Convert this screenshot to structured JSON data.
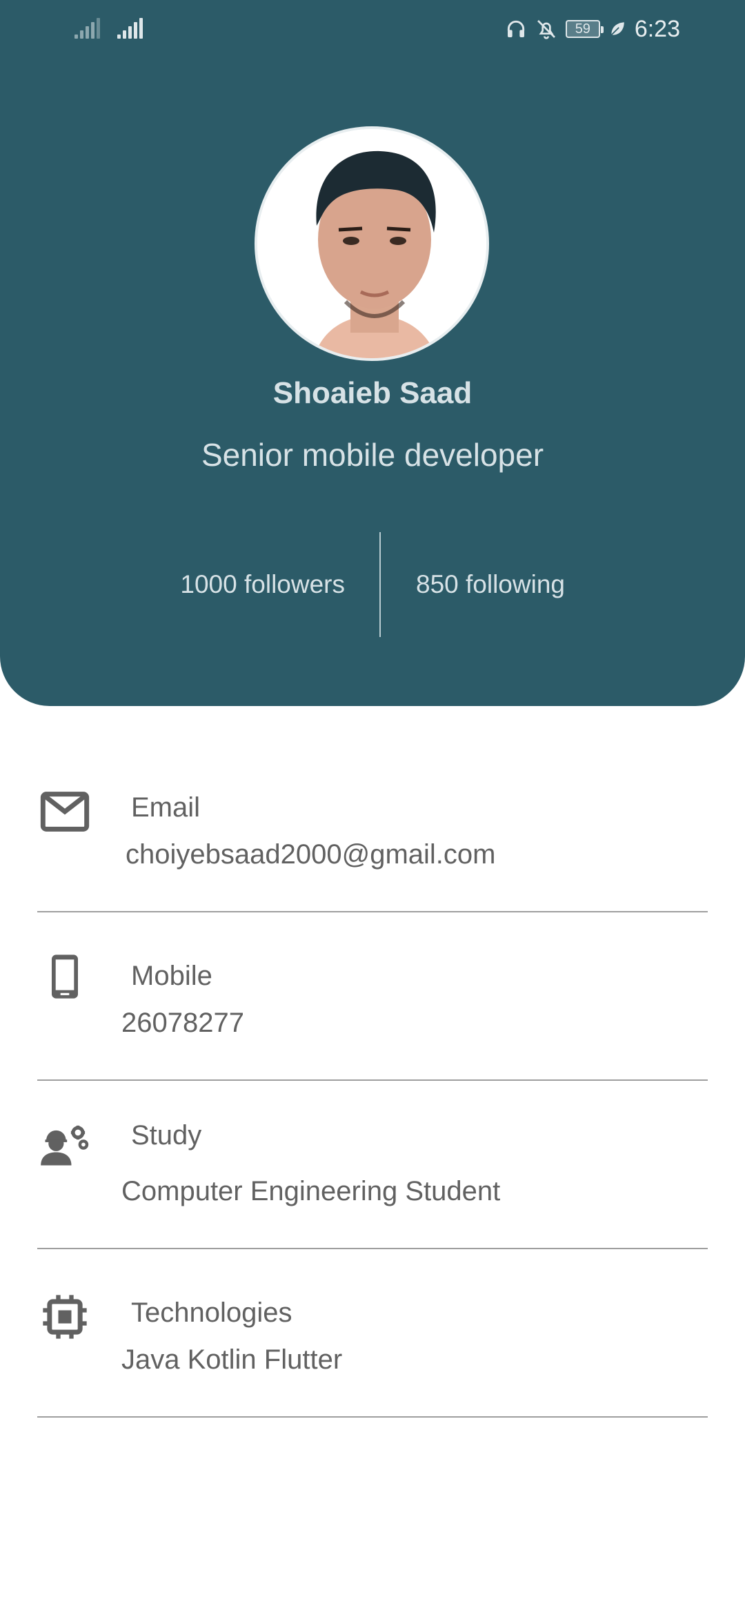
{
  "status_bar": {
    "battery": "59",
    "time": "6:23"
  },
  "profile": {
    "name": "Shoaieb Saad",
    "role": "Senior mobile developer",
    "followers": "1000 followers",
    "following": "850 following"
  },
  "info": [
    {
      "icon": "email-icon",
      "label": "Email",
      "value": "choiyebsaad2000@gmail.com"
    },
    {
      "icon": "mobile-phone-icon",
      "label": "Mobile",
      "value": "26078277"
    },
    {
      "icon": "engineer-icon",
      "label": "Study",
      "value": "Computer Engineering Student"
    },
    {
      "icon": "chip-icon",
      "label": "Technologies",
      "value": "Java Kotlin Flutter"
    }
  ],
  "colors": {
    "header": "#2c5b68",
    "header_text": "#d7e2e6",
    "body_text": "#616161",
    "divider": "#9e9e9e"
  }
}
